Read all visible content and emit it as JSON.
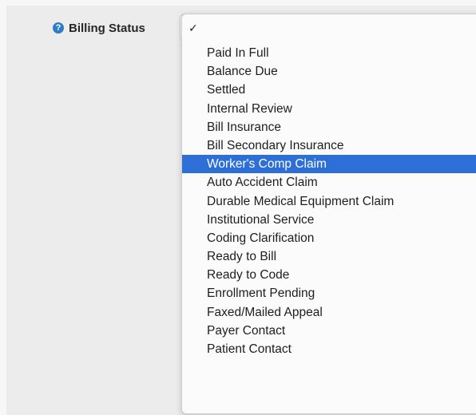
{
  "form": {
    "field_label": "Billing Status",
    "help_icon_glyph": "?",
    "help_icon_color": "#2e7cc4"
  },
  "dropdown": {
    "selected_marker": "✓",
    "highlight_color": "#2d6fd6",
    "highlighted_index": 6,
    "options": [
      "Paid In Full",
      "Balance Due",
      "Settled",
      "Internal Review",
      "Bill Insurance",
      "Bill Secondary Insurance",
      "Worker's Comp Claim",
      "Auto Accident Claim",
      "Durable Medical Equipment Claim",
      "Institutional Service",
      "Coding Clarification",
      "Ready to Bill",
      "Ready to Code",
      "Enrollment Pending",
      "Faxed/Mailed Appeal",
      "Payer Contact",
      "Patient Contact"
    ]
  }
}
